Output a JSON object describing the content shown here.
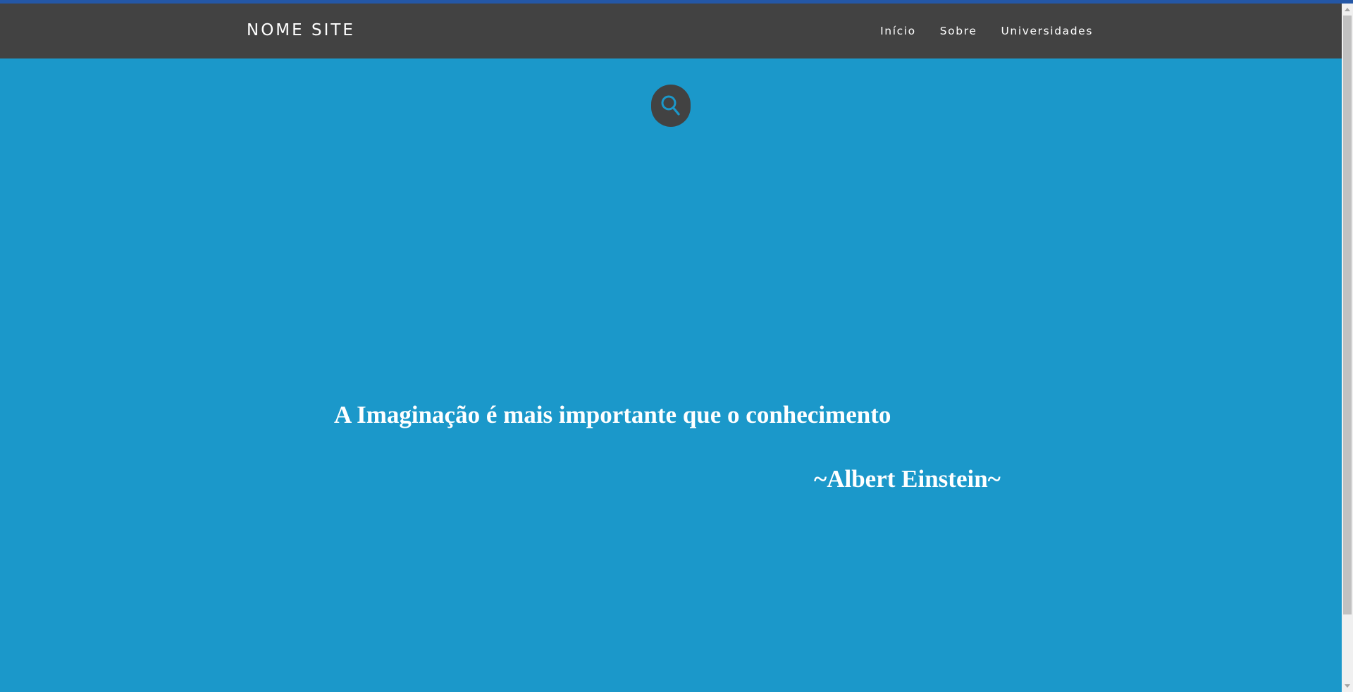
{
  "header": {
    "brand": "NOME SITE",
    "nav": [
      {
        "label": "Início"
      },
      {
        "label": "Sobre"
      },
      {
        "label": "Universidades"
      }
    ]
  },
  "main": {
    "search_icon": "search-icon",
    "quote": "A Imaginação é mais importante que o conhecimento",
    "author": "~Albert Einstein~"
  },
  "colors": {
    "navbar": "#424242",
    "background": "#1b98ca",
    "text": "#ffffff",
    "icon_stroke": "#1b98ca"
  }
}
